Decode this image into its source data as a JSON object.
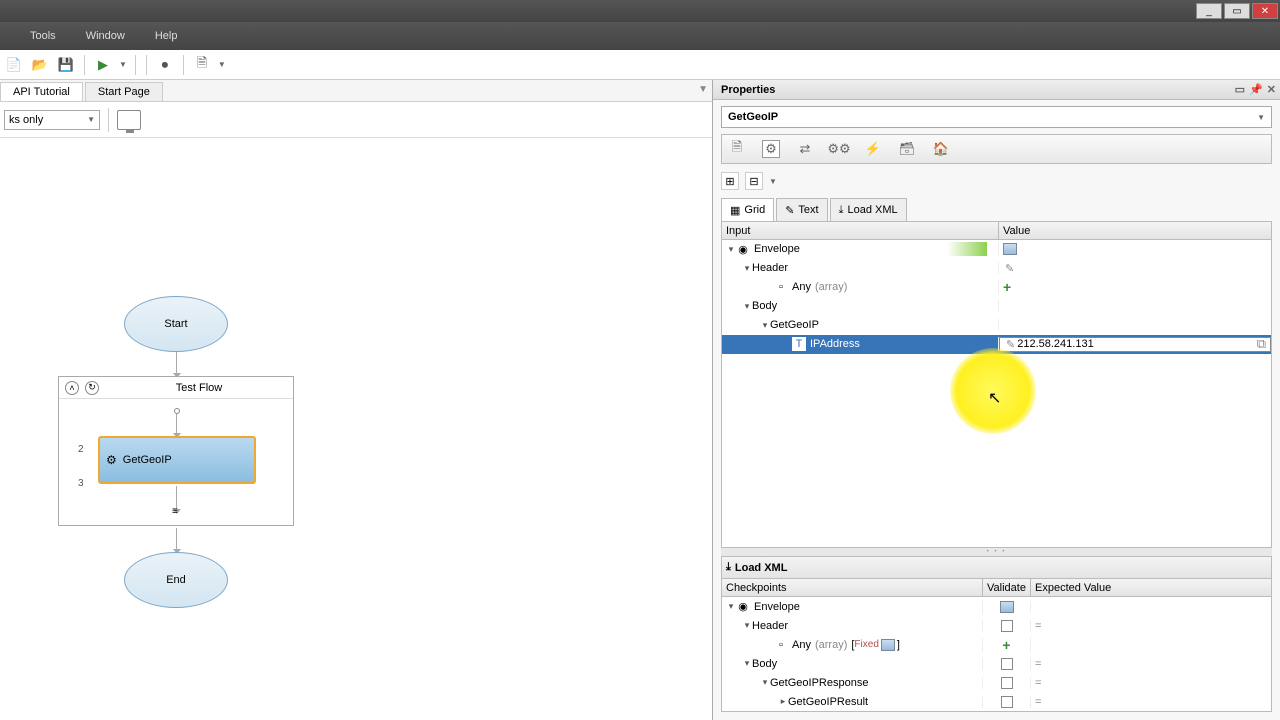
{
  "menubar": {
    "tools": "Tools",
    "window": "Window",
    "help": "Help"
  },
  "tabs": {
    "active": "API Tutorial",
    "other": "Start Page"
  },
  "displayMode": "ks only",
  "flow": {
    "start": "Start",
    "end": "End",
    "container": "Test Flow",
    "step1": "GetGeoIP",
    "num2": "2",
    "num3": "3",
    "handle": "≡"
  },
  "properties": {
    "title": "Properties",
    "object": "GetGeoIP",
    "viewTabs": {
      "grid": "Grid",
      "text": "Text",
      "loadxml": "Load XML"
    },
    "cols": {
      "input": "Input",
      "value": "Value"
    },
    "tree": {
      "envelope": "Envelope",
      "header": "Header",
      "any": "Any",
      "array": "(array)",
      "body": "Body",
      "getgeoip": "GetGeoIP",
      "ipaddress": "IPAddress",
      "ipvalue": "212.58.241.131"
    }
  },
  "checkpoints": {
    "loadxml": "Load XML",
    "cols": {
      "checkpoints": "Checkpoints",
      "validate": "Validate",
      "expected": "Expected Value"
    },
    "tree": {
      "envelope": "Envelope",
      "header": "Header",
      "any": "Any",
      "array": "(array)",
      "fixed": "Fixed",
      "body": "Body",
      "response": "GetGeoIPResponse",
      "result": "GetGeoIPResult"
    },
    "eq": "="
  }
}
